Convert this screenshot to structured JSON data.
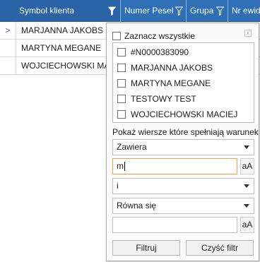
{
  "grid": {
    "columns": [
      {
        "label": "Symbol klienta"
      },
      {
        "label": "Numer Pesel"
      },
      {
        "label": "Grupa"
      },
      {
        "label": "Nr ewid"
      }
    ],
    "current_row_marker": ">",
    "rows": [
      {
        "symbol": "MARJANNA JAKOBS"
      },
      {
        "symbol": "MARTYNA MEGANE"
      },
      {
        "symbol": "WOJCIECHOWSKI MACI"
      }
    ]
  },
  "filter": {
    "select_all_label": "Zaznacz wszystkie",
    "close_glyph": "x",
    "items": [
      {
        "label": "#N0000383090"
      },
      {
        "label": "MARJANNA JAKOBS"
      },
      {
        "label": "MARTYNA MEGANE"
      },
      {
        "label": "TESTOWY TEST"
      },
      {
        "label": "WOJCIECHOWSKI MACIEJ"
      }
    ],
    "condition_label": "Pokaż wiersze które spełniają warunek",
    "operator1": "Zawiera",
    "value1": "m",
    "case_label": "aA",
    "logic": "i",
    "operator2": "Równa się",
    "value2": "",
    "filter_button": "Filtruj",
    "clear_button": "Czyść filtr"
  },
  "colors": {
    "header_bg": "#2f6fb6",
    "focus_border": "#f0a33a"
  }
}
